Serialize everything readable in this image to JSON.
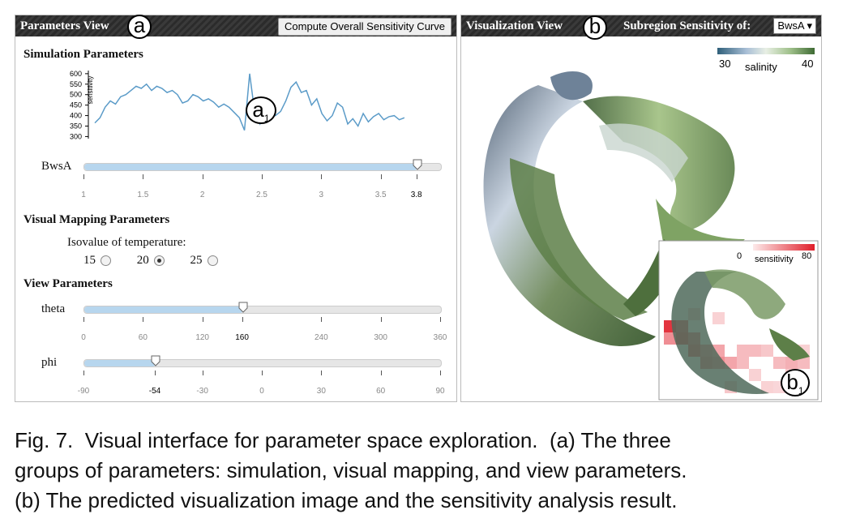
{
  "left_panel": {
    "title": "Parameters View",
    "marker": "a",
    "compute_button": "Compute Overall Sensitivity Curve",
    "simulation": {
      "heading": "Simulation Parameters",
      "chart_marker": "a",
      "chart_marker_sub": "1",
      "slider_label": "BwsA",
      "ticks": [
        "1",
        "1.5",
        "2",
        "2.5",
        "3",
        "3.5"
      ],
      "tick_values": [
        1,
        1.5,
        2,
        2.5,
        3,
        3.5
      ],
      "range": [
        1,
        4
      ],
      "value": "3.8",
      "value_num": 3.8
    },
    "visual_mapping": {
      "heading": "Visual Mapping Parameters",
      "isovalue_label": "Isovalue of temperature:",
      "options": [
        "15",
        "20",
        "25"
      ],
      "selected": "20"
    },
    "view": {
      "heading": "View Parameters",
      "theta": {
        "label": "theta",
        "ticks": [
          "0",
          "60",
          "120",
          "240",
          "300",
          "360"
        ],
        "tick_values": [
          0,
          60,
          120,
          240,
          300,
          360
        ],
        "range": [
          0,
          360
        ],
        "value": "160",
        "value_num": 160
      },
      "phi": {
        "label": "phi",
        "ticks": [
          "-90",
          "-30",
          "0",
          "30",
          "60",
          "90"
        ],
        "tick_values": [
          -90,
          -30,
          0,
          30,
          60,
          90
        ],
        "range": [
          -90,
          90
        ],
        "value": "-54",
        "value_num": -54
      }
    }
  },
  "right_panel": {
    "title": "Visualization View",
    "marker": "b",
    "subregion_label": "Subregion Sensitivity of:",
    "dropdown_value": "BwsA",
    "colorbar": {
      "min": "30",
      "max": "40",
      "label": "salinity",
      "colors": [
        "#2f5f7a",
        "#a9bfd6",
        "#e8efe4",
        "#9fc08a",
        "#3f6b34"
      ]
    },
    "inset": {
      "min": "0",
      "max": "80",
      "label": "sensitivity",
      "marker": "b",
      "marker_sub": "1",
      "colors": [
        "#fdeaea",
        "#e01e2a"
      ]
    }
  },
  "chart_data": {
    "type": "line",
    "title": "",
    "xlabel": "",
    "ylabel": "sensitivity",
    "yticks": [
      300,
      350,
      400,
      450,
      500,
      550,
      600
    ],
    "ylim": [
      290,
      615
    ],
    "x": [
      1.0,
      1.05,
      1.1,
      1.15,
      1.2,
      1.25,
      1.3,
      1.35,
      1.4,
      1.45,
      1.5,
      1.55,
      1.6,
      1.65,
      1.7,
      1.75,
      1.8,
      1.85,
      1.9,
      1.95,
      2.0,
      2.05,
      2.1,
      2.15,
      2.2,
      2.25,
      2.3,
      2.35,
      2.4,
      2.45,
      2.5,
      2.55,
      2.6,
      2.65,
      2.7,
      2.75,
      2.8,
      2.85,
      2.9,
      2.95,
      3.0,
      3.05,
      3.1,
      3.15,
      3.2,
      3.25,
      3.3,
      3.35,
      3.4,
      3.45,
      3.5,
      3.55,
      3.6,
      3.65,
      3.7,
      3.75,
      3.8,
      3.85,
      3.9,
      3.95,
      4.0
    ],
    "series": [
      {
        "values": [
          365,
          390,
          440,
          470,
          455,
          490,
          500,
          520,
          540,
          530,
          550,
          520,
          540,
          530,
          510,
          520,
          500,
          460,
          470,
          500,
          490,
          470,
          480,
          465,
          440,
          455,
          440,
          415,
          390,
          330,
          600,
          410,
          360,
          440,
          450,
          400,
          420,
          470,
          535,
          560,
          510,
          520,
          450,
          480,
          410,
          375,
          400,
          460,
          440,
          360,
          385,
          350,
          410,
          370,
          395,
          410,
          380,
          395,
          400,
          380,
          390
        ],
        "color": "#5b9bc8"
      }
    ]
  }
}
